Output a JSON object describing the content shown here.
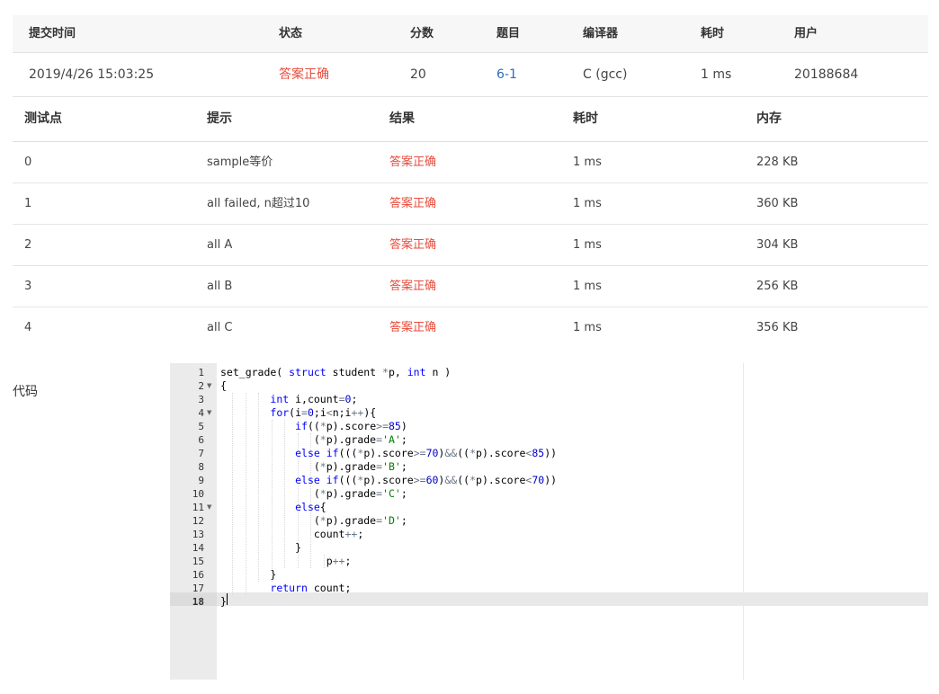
{
  "submission": {
    "headers": [
      "提交时间",
      "状态",
      "分数",
      "题目",
      "编译器",
      "耗时",
      "用户"
    ],
    "time": "2019/4/26 15:03:25",
    "status": "答案正确",
    "score": "20",
    "problem": "6-1",
    "compiler": "C (gcc)",
    "elapsed": "1 ms",
    "user": "20188684"
  },
  "testcases": {
    "headers": [
      "测试点",
      "提示",
      "结果",
      "耗时",
      "内存"
    ],
    "rows": [
      {
        "id": "0",
        "hint": "sample等价",
        "result": "答案正确",
        "time": "1 ms",
        "memory": "228 KB"
      },
      {
        "id": "1",
        "hint": "all failed, n超过10",
        "result": "答案正确",
        "time": "1 ms",
        "memory": "360 KB"
      },
      {
        "id": "2",
        "hint": "all A",
        "result": "答案正确",
        "time": "1 ms",
        "memory": "304 KB"
      },
      {
        "id": "3",
        "hint": "all B",
        "result": "答案正确",
        "time": "1 ms",
        "memory": "256 KB"
      },
      {
        "id": "4",
        "hint": "all C",
        "result": "答案正确",
        "time": "1 ms",
        "memory": "356 KB"
      }
    ]
  },
  "code_label": "代码",
  "colors": {
    "status_ok": "#e74c3c",
    "link": "#2a6ebb",
    "keyword": "#0000ff",
    "string": "#008000"
  },
  "editor": {
    "line_numbers": [
      "1",
      "2",
      "3",
      "4",
      "5",
      "6",
      "7",
      "8",
      "9",
      "10",
      "11",
      "12",
      "13",
      "14",
      "15",
      "16",
      "17",
      "18"
    ],
    "foldable_lines": [
      "2",
      "4",
      "11"
    ],
    "active_line": "18"
  }
}
